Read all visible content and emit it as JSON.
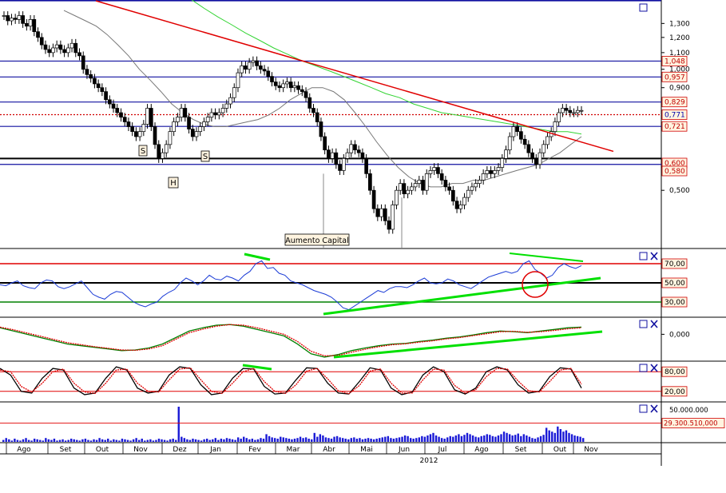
{
  "chart_data": [
    {
      "type": "candlestick",
      "panel": "price",
      "y_scale": "log",
      "ylim": [
        0.36,
        1.48
      ],
      "y_ticks": [
        "1,300",
        "1,200",
        "1,100",
        "1,000",
        "0,900",
        "0,500"
      ],
      "price_labels": [
        {
          "text": "1,048",
          "value": 1.048,
          "color": "#c00000"
        },
        {
          "text": "0,957",
          "value": 0.957,
          "color": "#c00000"
        },
        {
          "text": "0,829",
          "value": 0.829,
          "color": "#c00000"
        },
        {
          "text": "0,771",
          "value": 0.771,
          "color": "#0000aa"
        },
        {
          "text": "0,721",
          "value": 0.721,
          "color": "#c00000"
        },
        {
          "text": "0,600",
          "value": 0.6,
          "color": "#c00000"
        },
        {
          "text": "0,580",
          "value": 0.58,
          "color": "#c00000"
        }
      ],
      "horizontal_lines": [
        {
          "value": 1.48,
          "color": "#1010a0",
          "style": "solid"
        },
        {
          "value": 1.048,
          "color": "#1010a0",
          "style": "solid"
        },
        {
          "value": 0.957,
          "color": "#1010a0",
          "style": "solid"
        },
        {
          "value": 0.829,
          "color": "#1010a0",
          "style": "solid"
        },
        {
          "value": 0.771,
          "color": "#d00000",
          "style": "dotted"
        },
        {
          "value": 0.721,
          "color": "#1010a0",
          "style": "solid"
        },
        {
          "value": 0.6,
          "color": "#000000",
          "style": "solid"
        },
        {
          "value": 0.58,
          "color": "#1010a0",
          "style": "solid"
        }
      ],
      "trendline": {
        "color": "#e00000",
        "from": [
          0.0,
          1.48
        ],
        "to": [
          0.92,
          0.625
        ]
      },
      "close_series": [
        1.36,
        1.32,
        1.34,
        1.33,
        1.36,
        1.3,
        1.28,
        1.33,
        1.24,
        1.2,
        1.15,
        1.12,
        1.1,
        1.13,
        1.15,
        1.12,
        1.1,
        1.13,
        1.16,
        1.1,
        1.08,
        1.0,
        0.97,
        0.95,
        0.92,
        0.9,
        0.88,
        0.84,
        0.82,
        0.8,
        0.78,
        0.76,
        0.74,
        0.72,
        0.7,
        0.68,
        0.7,
        0.73,
        0.8,
        0.72,
        0.65,
        0.6,
        0.62,
        0.65,
        0.7,
        0.74,
        0.76,
        0.8,
        0.76,
        0.71,
        0.68,
        0.7,
        0.72,
        0.74,
        0.76,
        0.78,
        0.77,
        0.78,
        0.8,
        0.82,
        0.85,
        0.9,
        0.98,
        1.02,
        1.0,
        1.04,
        1.05,
        1.02,
        1.0,
        0.99,
        0.96,
        0.93,
        0.91,
        0.9,
        0.92,
        0.93,
        0.9,
        0.91,
        0.89,
        0.88,
        0.85,
        0.8,
        0.78,
        0.74,
        0.68,
        0.63,
        0.6,
        0.62,
        0.58,
        0.56,
        0.6,
        0.62,
        0.65,
        0.63,
        0.62,
        0.6,
        0.55,
        0.5,
        0.45,
        0.43,
        0.45,
        0.42,
        0.4,
        0.46,
        0.5,
        0.52,
        0.49,
        0.5,
        0.51,
        0.52,
        0.53,
        0.5,
        0.55,
        0.56,
        0.57,
        0.55,
        0.53,
        0.51,
        0.5,
        0.47,
        0.45,
        0.46,
        0.48,
        0.5,
        0.51,
        0.52,
        0.53,
        0.55,
        0.56,
        0.55,
        0.56,
        0.57,
        0.6,
        0.63,
        0.68,
        0.72,
        0.7,
        0.67,
        0.65,
        0.62,
        0.6,
        0.58,
        0.62,
        0.65,
        0.68,
        0.7,
        0.74,
        0.78,
        0.8,
        0.79,
        0.78,
        0.78,
        0.79,
        0.79
      ],
      "ma_gray": [
        1.4,
        1.36,
        1.32,
        1.28,
        1.22,
        1.15,
        1.08,
        1.0,
        0.94,
        0.88,
        0.82,
        0.78,
        0.75,
        0.73,
        0.72,
        0.72,
        0.73,
        0.74,
        0.75,
        0.77,
        0.8,
        0.84,
        0.87,
        0.9,
        0.9,
        0.88,
        0.84,
        0.78,
        0.72,
        0.66,
        0.61,
        0.57,
        0.54,
        0.52,
        0.51,
        0.51,
        0.52,
        0.52,
        0.53,
        0.53,
        0.54,
        0.55,
        0.56,
        0.57,
        0.58,
        0.6,
        0.62,
        0.65,
        0.68
      ],
      "ma_green": [
        1.6,
        1.5,
        1.42,
        1.35,
        1.29,
        1.23,
        1.18,
        1.13,
        1.09,
        1.05,
        1.02,
        0.99,
        0.96,
        0.93,
        0.9,
        0.87,
        0.85,
        0.82,
        0.8,
        0.78,
        0.77,
        0.76,
        0.75,
        0.74,
        0.73,
        0.72,
        0.71,
        0.7,
        0.7,
        0.69
      ],
      "volume_spike_low": [
        0.39,
        0.41
      ],
      "annotations": [
        {
          "text": "S",
          "style": "pattern"
        },
        {
          "text": "H",
          "style": "pattern"
        },
        {
          "text": "S",
          "style": "pattern"
        },
        {
          "text": "Aumento Capital",
          "style": "event"
        }
      ]
    },
    {
      "type": "line",
      "panel": "rsi",
      "ylim": [
        0,
        100
      ],
      "levels": [
        {
          "value": 70,
          "label": "70,00",
          "color": "#e00000"
        },
        {
          "value": 50,
          "label": "50,00",
          "color": "#000000"
        },
        {
          "value": 30,
          "label": "30,00",
          "color": "#008000"
        }
      ],
      "values": [
        48,
        47,
        50,
        52,
        47,
        45,
        44,
        50,
        53,
        52,
        46,
        44,
        46,
        49,
        52,
        45,
        38,
        35,
        33,
        38,
        41,
        40,
        35,
        30,
        27,
        25,
        28,
        30,
        36,
        40,
        43,
        50,
        55,
        52,
        48,
        52,
        58,
        54,
        53,
        57,
        55,
        52,
        58,
        62,
        70,
        73,
        65,
        66,
        60,
        58,
        52,
        50,
        48,
        45,
        42,
        40,
        38,
        35,
        30,
        24,
        22,
        26,
        30,
        34,
        38,
        42,
        40,
        44,
        46,
        46,
        45,
        48,
        52,
        55,
        50,
        49,
        50,
        54,
        52,
        48,
        46,
        44,
        48,
        52,
        56,
        58,
        60,
        62,
        60,
        62,
        70,
        73,
        64,
        60,
        55,
        58,
        66,
        70,
        67,
        65,
        68
      ]
    },
    {
      "type": "line",
      "panel": "macd",
      "levels": [
        {
          "value": 0,
          "label": "0,000"
        }
      ],
      "series": [
        {
          "color": "#008000",
          "values": [
            0.2,
            0.1,
            0.0,
            -0.1,
            -0.2,
            -0.3,
            -0.35,
            -0.4,
            -0.45,
            -0.5,
            -0.48,
            -0.42,
            -0.3,
            -0.1,
            0.1,
            0.2,
            0.28,
            0.3,
            0.25,
            0.15,
            0.05,
            -0.05,
            -0.3,
            -0.6,
            -0.7,
            -0.62,
            -0.5,
            -0.42,
            -0.35,
            -0.3,
            -0.28,
            -0.22,
            -0.18,
            -0.12,
            -0.08,
            -0.02,
            0.05,
            0.1,
            0.08,
            0.05,
            0.1,
            0.15,
            0.2,
            0.22
          ]
        },
        {
          "color": "#e00000",
          "values": [
            0.22,
            0.14,
            0.04,
            -0.06,
            -0.16,
            -0.26,
            -0.32,
            -0.38,
            -0.43,
            -0.48,
            -0.49,
            -0.45,
            -0.35,
            -0.15,
            0.05,
            0.16,
            0.25,
            0.3,
            0.28,
            0.2,
            0.1,
            0.0,
            -0.22,
            -0.52,
            -0.66,
            -0.65,
            -0.55,
            -0.46,
            -0.38,
            -0.32,
            -0.29,
            -0.24,
            -0.2,
            -0.14,
            -0.1,
            -0.04,
            0.02,
            0.08,
            0.09,
            0.06,
            0.08,
            0.12,
            0.17,
            0.2
          ]
        }
      ]
    },
    {
      "type": "line",
      "panel": "stochastic",
      "ylim": [
        0,
        100
      ],
      "levels": [
        {
          "value": 80,
          "label": "80,00",
          "color": "#e00000"
        },
        {
          "value": 20,
          "label": "20,00",
          "color": "#e00000"
        }
      ],
      "series": [
        {
          "color": "#000000",
          "values": [
            90,
            70,
            20,
            15,
            60,
            90,
            85,
            30,
            10,
            15,
            60,
            95,
            85,
            30,
            15,
            20,
            70,
            95,
            90,
            40,
            10,
            15,
            60,
            90,
            88,
            35,
            12,
            15,
            55,
            92,
            90,
            45,
            15,
            12,
            50,
            92,
            85,
            30,
            10,
            18,
            70,
            95,
            80,
            25,
            12,
            30,
            80,
            95,
            85,
            40,
            15,
            20,
            65,
            92,
            88,
            30
          ]
        },
        {
          "color": "#e00000",
          "values": [
            85,
            80,
            35,
            18,
            45,
            80,
            88,
            45,
            18,
            14,
            45,
            85,
            88,
            45,
            20,
            18,
            55,
            88,
            92,
            55,
            20,
            14,
            45,
            80,
            90,
            50,
            20,
            14,
            40,
            82,
            90,
            58,
            22,
            13,
            38,
            82,
            88,
            45,
            15,
            15,
            55,
            88,
            85,
            38,
            15,
            25,
            65,
            90,
            88,
            52,
            22,
            18,
            50,
            85,
            90,
            42
          ]
        }
      ]
    },
    {
      "type": "bar",
      "panel": "volume",
      "y_ticks": [
        "50.000.000"
      ],
      "last_value_label": "29.300.510,000",
      "last_value": 29300510,
      "values": [
        3,
        6,
        4,
        2,
        5,
        3,
        2,
        4,
        6,
        3,
        2,
        5,
        4,
        3,
        2,
        6,
        4,
        3,
        5,
        2,
        3,
        4,
        2,
        3,
        5,
        4,
        3,
        2,
        4,
        5,
        3,
        2,
        4,
        3,
        6,
        4,
        3,
        5,
        2,
        4,
        3,
        2,
        5,
        4,
        3,
        2,
        4,
        6,
        3,
        5,
        2,
        3,
        4,
        2,
        3,
        5,
        4,
        3,
        2,
        4,
        5,
        3,
        55,
        8,
        6,
        4,
        3,
        5,
        4,
        3,
        2,
        4,
        5,
        3,
        4,
        6,
        3,
        5,
        4,
        6,
        5,
        4,
        3,
        7,
        5,
        8,
        6,
        4,
        5,
        3,
        4,
        6,
        5,
        12,
        9,
        7,
        6,
        5,
        8,
        7,
        6,
        5,
        4,
        5,
        6,
        8,
        6,
        7,
        5,
        4,
        14,
        8,
        12,
        10,
        7,
        6,
        5,
        8,
        9,
        7,
        6,
        5,
        4,
        6,
        7,
        5,
        6,
        4,
        5,
        6,
        5,
        4,
        5,
        6,
        7,
        8,
        9,
        6,
        5,
        6,
        7,
        8,
        10,
        9,
        6,
        5,
        6,
        7,
        9,
        8,
        10,
        12,
        14,
        10,
        8,
        6,
        5,
        7,
        9,
        8,
        10,
        12,
        9,
        11,
        14,
        12,
        10,
        8,
        7,
        9,
        10,
        12,
        11,
        9,
        8,
        10,
        12,
        16,
        14,
        12,
        10,
        11,
        13,
        9,
        12,
        10,
        8,
        6,
        5,
        7,
        9,
        11,
        22,
        18,
        16,
        14,
        24,
        20,
        16,
        18,
        14,
        12,
        10,
        9,
        8,
        6
      ]
    }
  ],
  "x_axis": {
    "months": [
      "Ago",
      "Set",
      "Out",
      "Nov",
      "Dez",
      "Jan",
      "Fev",
      "Mar",
      "Abr",
      "Mai",
      "Jun",
      "Jul",
      "Ago",
      "Set",
      "Out",
      "Nov"
    ],
    "year_label": "2012"
  },
  "panel_icons": [
    "box-icon",
    "close-icon"
  ],
  "colors": {
    "background": "#ffffff",
    "grid_blue": "#1010a0",
    "trend_red": "#e00000",
    "support_green": "#00e000",
    "rsi_line": "#1a3bd6",
    "label_box_bg": "#fff4e0",
    "label_box_border": "#d00000"
  }
}
